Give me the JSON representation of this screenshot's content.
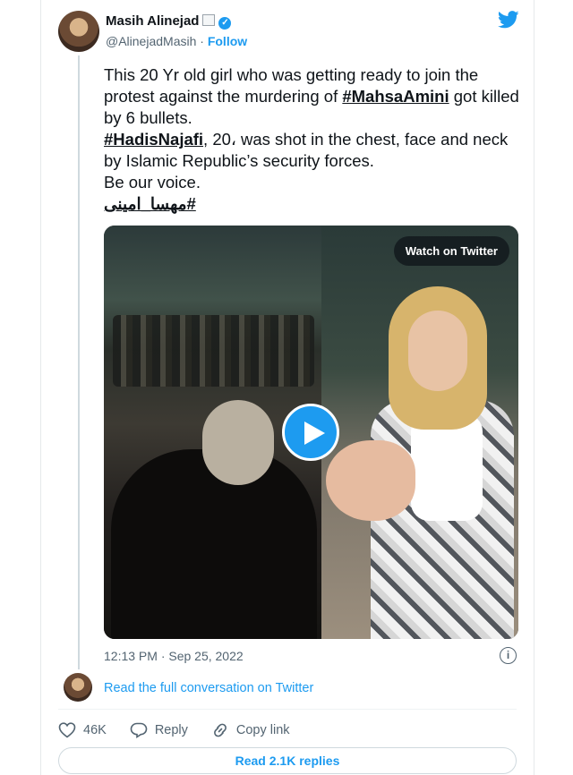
{
  "author": {
    "name": "Masih Alinejad",
    "handle": "@AlinejadMasih",
    "separator": " · ",
    "follow_label": "Follow"
  },
  "tweet": {
    "line1_prefix": "This 20 Yr old girl who was getting ready to join the protest against the murdering of ",
    "hashtag1": "#MahsaAmini",
    "line1_suffix": " got killed by 6 bullets.",
    "hashtag2": "#HadisNajafi",
    "line2_suffix": ", 20، was shot in the chest, face and neck by Islamic Republic’s security forces.",
    "line3": "Be our voice.",
    "hashtag3": "#مهسا_امینی"
  },
  "media": {
    "watch_label": "Watch on Twitter"
  },
  "timestamp": "12:13 PM · Sep 25, 2022",
  "info_glyph": "i",
  "conversation_link": "Read the full conversation on Twitter",
  "actions": {
    "likes": "46K",
    "reply": "Reply",
    "copy": "Copy link"
  },
  "read_replies": "Read 2.1K replies",
  "colors": {
    "accent": "#1d9bf0",
    "text": "#0f1419",
    "muted": "#536471"
  },
  "icons": [
    "twitter-bird-icon",
    "verified-badge-icon",
    "flag-icon",
    "play-icon",
    "info-icon",
    "heart-icon",
    "reply-icon",
    "link-icon"
  ]
}
